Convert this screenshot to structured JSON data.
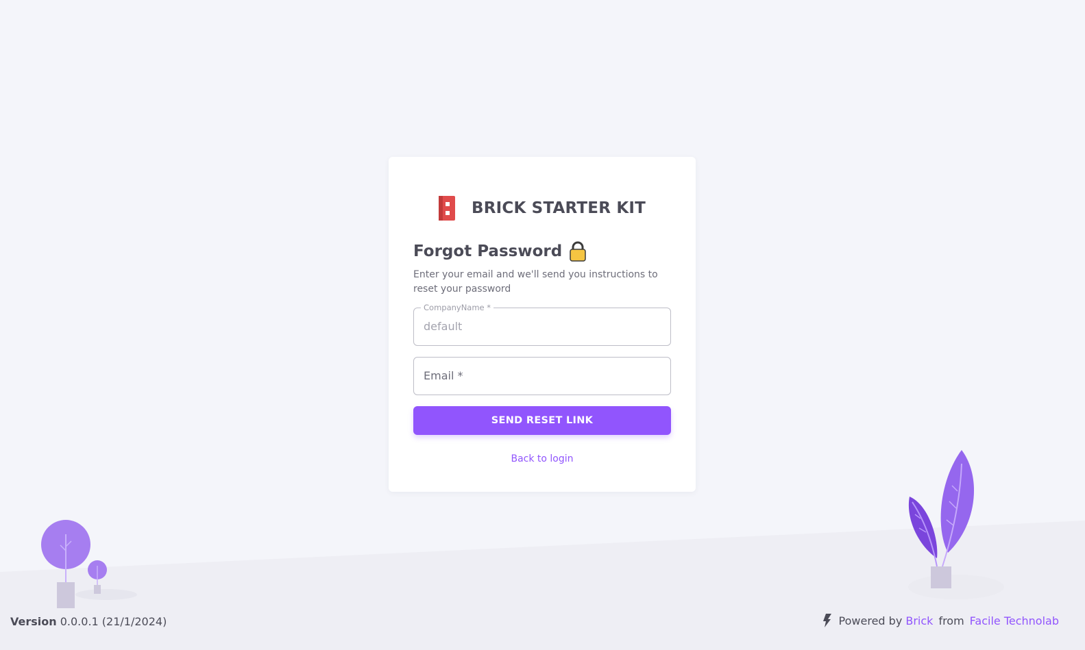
{
  "brand": {
    "name": "BRICK STARTER KIT",
    "logo_icon": "brick-logo-icon"
  },
  "form": {
    "title": "Forgot Password",
    "title_icon": "lock-icon",
    "subtitle": "Enter your email and we'll send you instructions to reset your password",
    "company_field": {
      "label": "CompanyName *",
      "value": "default"
    },
    "email_field": {
      "label": "Email *",
      "value": ""
    },
    "submit_label": "SEND RESET LINK",
    "back_link": "Back to login"
  },
  "footer": {
    "version_label": "Version",
    "version_value": "0.0.0.1 (21/1/2024)",
    "powered_by": "Powered by",
    "brick_link": "Brick",
    "from_text": "from",
    "company_link": "Facile Technolab"
  },
  "colors": {
    "accent": "#9155fd",
    "background": "#f4f5fa",
    "card": "#ffffff",
    "text": "#4b4b57",
    "brand_red": "#e04b4b"
  }
}
